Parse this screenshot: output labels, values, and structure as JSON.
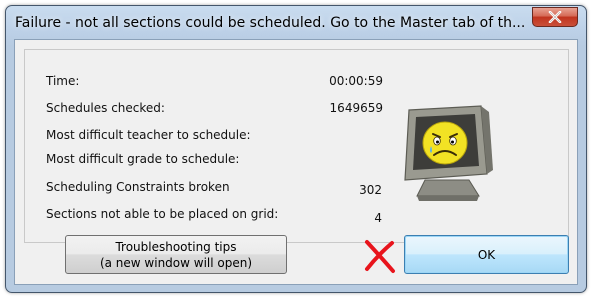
{
  "window": {
    "title": "Failure - not all sections could be scheduled. Go to the Master tab of th..."
  },
  "stats": [
    {
      "label": "Time:",
      "value": "00:00:59"
    },
    {
      "label": "Schedules checked:",
      "value": "1649659"
    },
    {
      "label": "Most difficult teacher to schedule:",
      "value": ""
    },
    {
      "label": "Most difficult grade to schedule:",
      "value": ""
    },
    {
      "label": "Scheduling Constraints broken",
      "value": "302"
    },
    {
      "label": "Sections not able to be placed on grid:",
      "value": "4"
    }
  ],
  "buttons": {
    "tips_line1": "Troubleshooting tips",
    "tips_line2": "(a new window will open)",
    "ok": "OK"
  },
  "icons": {
    "close": "close-icon",
    "sad_monitor": "sad-computer-icon",
    "red_x": "red-x-mark"
  },
  "colors": {
    "title_bar": "#bcd0e7",
    "close_button": "#c9503a",
    "ok_button_border": "#3c7fb1",
    "red_mark": "#e8141c"
  }
}
